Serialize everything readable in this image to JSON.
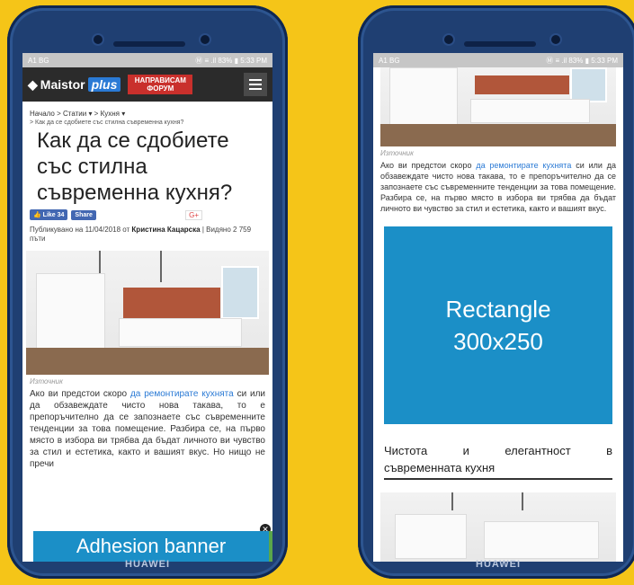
{
  "left_phone": {
    "brand": "HUAWEI",
    "status": {
      "carrier": "A1 BG",
      "right": "Ⓜ ≡ .il 83% ▮ 5:33 PM"
    },
    "header": {
      "logo_text": "Maistor",
      "logo_plus": "plus",
      "forum_line1": "НАПРАВИСАМ",
      "forum_line2": "ФОРУМ"
    },
    "breadcrumb": "Начало > Статии ▾ > Кухня ▾",
    "breadcrumb_sub": "> Как да се сдобиете със стилна съвременна кухня?",
    "title": "Как да се сдобиете със стилна съвременна кухня?",
    "social": {
      "like": "Like 34",
      "share": "Share",
      "gplus": "G+"
    },
    "meta_prefix": "Публикувано на 11/04/2018 от",
    "meta_author": "Кристина Кацарска",
    "meta_suffix": "| Видяно 2 759 пъти",
    "image_source": "Източник",
    "para_start": "Ако ви предстои скоро",
    "para_link": "да ремонтирате кухнята",
    "para_rest": "си или да обзавеждате чисто нова такава, то е препоръчително да се запознаете със съвременните тенденции за това помещение. Разбира се, на първо място в избора ви трябва да бъдат личното ви чувство за стил и естетика, както и вашият вкус. Но нищо не пречи",
    "adhesion_label": "Adhesion banner",
    "close_glyph": "✕"
  },
  "right_phone": {
    "brand": "HUAWEI",
    "status": {
      "carrier": "A1 BG",
      "right": "Ⓜ ≡ .il 83% ▮ 5:33 PM"
    },
    "image_source": "Източник",
    "para_start": "Ако ви предстои скоро",
    "para_link": "да ремонтирате кухнята",
    "para_rest": "си или да обзавеждате чисто нова такава, то е препоръчително да се запознаете със съвременните тенденции за това помещение. Разбира се, на първо място в избора ви трябва да бъдат личното ви чувство за стил и естетика, както и вашият вкус.",
    "ad_line1": "Rectangle",
    "ad_line2": "300x250",
    "subhead_w1": "Чистота",
    "subhead_w2": "и",
    "subhead_w3": "елегантност",
    "subhead_w4": "в",
    "subhead_line2": "съвременната кухня"
  },
  "colors": {
    "background": "#f5c518",
    "phone_body": "#1f3f72",
    "ad_blue": "#1b8fc7",
    "link": "#2a7ad5"
  }
}
